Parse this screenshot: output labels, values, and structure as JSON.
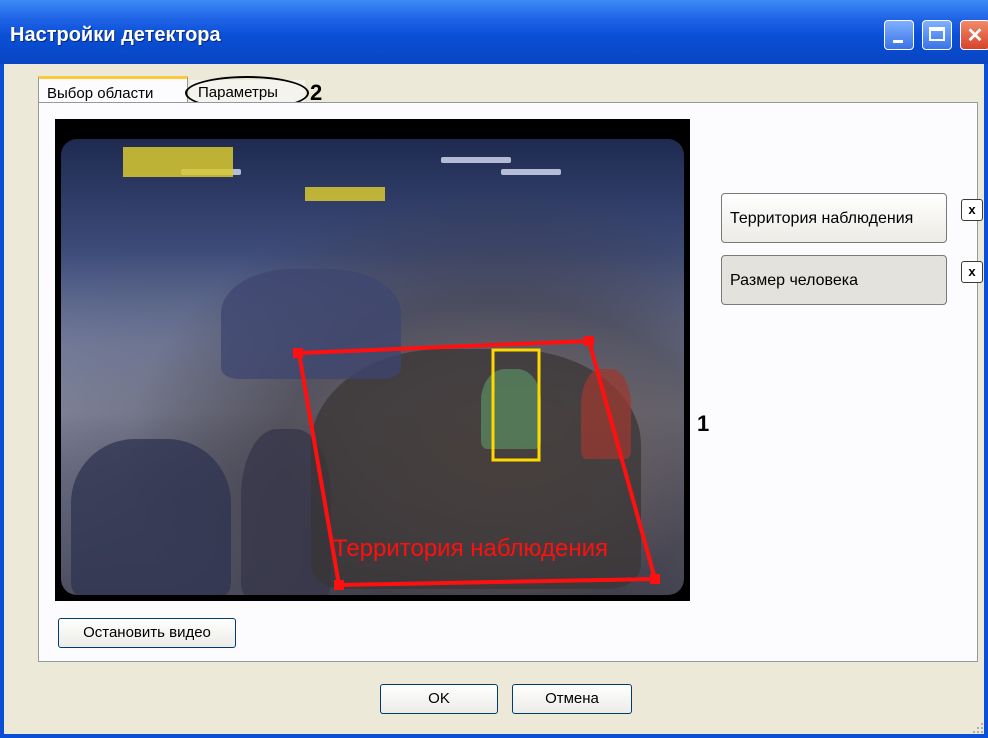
{
  "window": {
    "title": "Настройки детектора"
  },
  "tabs": [
    {
      "label": "Выбор области",
      "active": true
    },
    {
      "label": "Параметры",
      "active": false
    }
  ],
  "callouts": {
    "tabs_marker": "2",
    "video_marker": "1"
  },
  "video": {
    "roi_label": "Территория наблюдения",
    "roi_color": "#ff1010",
    "person_box_color": "#ffd800"
  },
  "side_buttons": [
    {
      "label": "Территория наблюдения",
      "remove": "x"
    },
    {
      "label": "Размер человека",
      "remove": "x"
    }
  ],
  "stop_video_label": "Остановить видео",
  "dialog_buttons": {
    "ok": "OK",
    "cancel": "Отмена"
  },
  "icons": [
    "minimize-icon",
    "maximize-icon",
    "close-icon",
    "resize-grip-icon"
  ]
}
